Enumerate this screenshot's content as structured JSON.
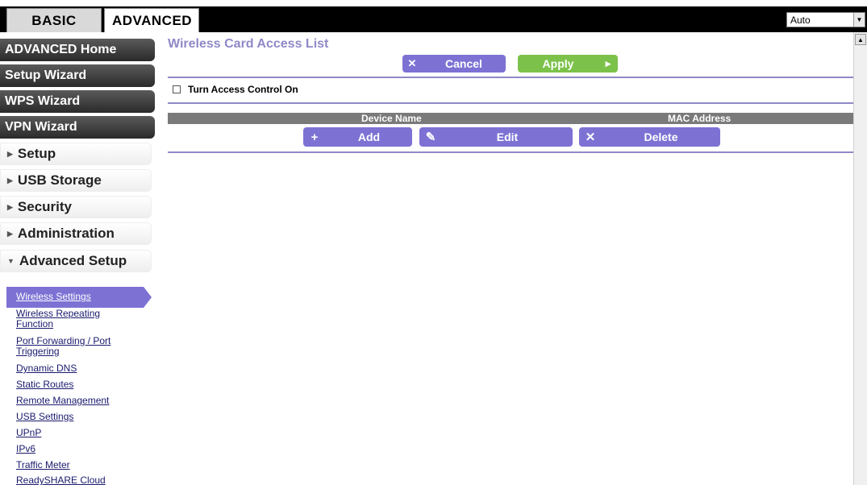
{
  "tabs": {
    "basic": "BASIC",
    "advanced": "ADVANCED"
  },
  "language_select": {
    "value": "Auto"
  },
  "sidebar": {
    "dark_items": [
      "ADVANCED Home",
      "Setup Wizard",
      "WPS Wizard",
      "VPN Wizard"
    ],
    "sections": [
      "Setup",
      "USB Storage",
      "Security",
      "Administration",
      "Advanced Setup"
    ],
    "sub_items": [
      "Wireless Settings",
      "Wireless Repeating",
      "Function",
      "Port Forwarding / Port",
      "Triggering",
      "Dynamic DNS",
      "Static Routes",
      "Remote Management",
      "USB Settings",
      "UPnP",
      "IPv6",
      "Traffic Meter",
      "ReadySHARE Cloud"
    ]
  },
  "main": {
    "title": "Wireless Card Access List",
    "cancel_label": "Cancel",
    "apply_label": "Apply",
    "access_control_label": "Turn Access Control On",
    "table": {
      "col_device": "Device Name",
      "col_mac": "MAC Address"
    },
    "add_label": "Add",
    "edit_label": "Edit",
    "delete_label": "Delete"
  },
  "icons": {
    "cancel": "x-icon",
    "apply": "play-arrow-icon",
    "add": "plus-icon",
    "edit": "pencil-icon",
    "delete": "x-icon"
  },
  "colors": {
    "accent_purple": "#7d72d4",
    "title_purple": "#8f89c8",
    "apply_green": "#7cc24a",
    "sidebar_dark": "#2a2a2a"
  }
}
